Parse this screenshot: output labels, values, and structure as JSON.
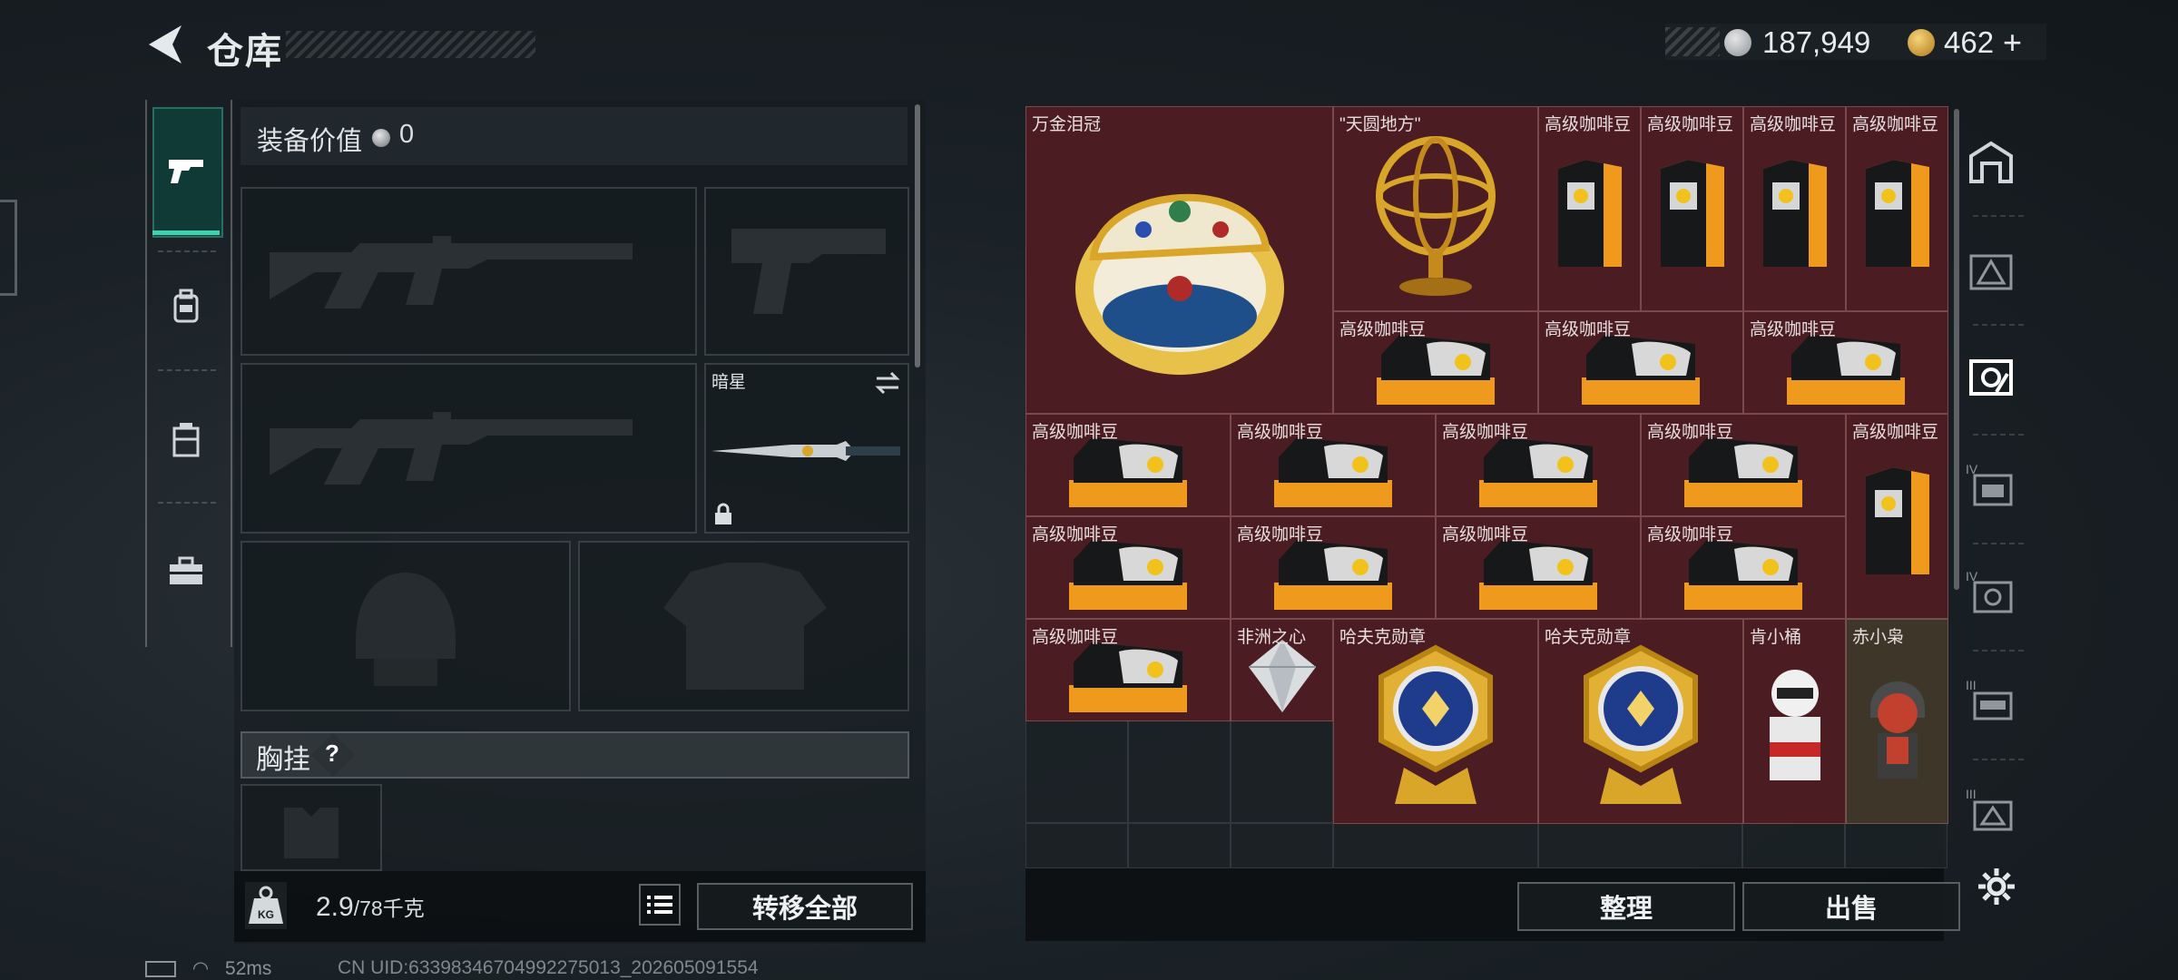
{
  "header": {
    "title": "仓库",
    "currency_silver": "187,949",
    "currency_gold": "462",
    "add_symbol": "+"
  },
  "equipment": {
    "value_label": "装备价值",
    "value": "0",
    "slot_melee_name": "暗星",
    "chest_label": "胸挂",
    "help_symbol": "?"
  },
  "footer_left": {
    "weight_current": "2.9",
    "weight_max": "/78",
    "weight_unit": "千克",
    "transfer_all": "转移全部"
  },
  "footer_right": {
    "organize": "整理",
    "sell": "出售"
  },
  "status": {
    "ping": "52ms",
    "uid": "CN UID:63398346704992275013_202605091554"
  },
  "items": [
    {
      "name": "万金泪冠"
    },
    {
      "name": "\"天圆地方\""
    },
    {
      "name": "高级咖啡豆"
    },
    {
      "name": "高级咖啡豆"
    },
    {
      "name": "高级咖啡豆"
    },
    {
      "name": "高级咖啡豆"
    },
    {
      "name": "高级咖啡豆"
    },
    {
      "name": "高级咖啡豆"
    },
    {
      "name": "高级咖啡豆"
    },
    {
      "name": "高级咖啡豆"
    },
    {
      "name": "高级咖啡豆"
    },
    {
      "name": "高级咖啡豆"
    },
    {
      "name": "高级咖啡豆"
    },
    {
      "name": "高级咖啡豆"
    },
    {
      "name": "高级咖啡豆"
    },
    {
      "name": "高级咖啡豆"
    },
    {
      "name": "高级咖啡豆"
    },
    {
      "name": "高级咖啡豆"
    },
    {
      "name": "高级咖啡豆"
    },
    {
      "name": "非洲之心"
    },
    {
      "name": "哈夫克勋章"
    },
    {
      "name": "哈夫克勋章"
    },
    {
      "name": "肯小桶"
    },
    {
      "name": "赤小枭"
    }
  ],
  "colors": {
    "accent": "#3ed2b0",
    "item_bg": "#4b1d22",
    "gold": "#d9a62a"
  }
}
